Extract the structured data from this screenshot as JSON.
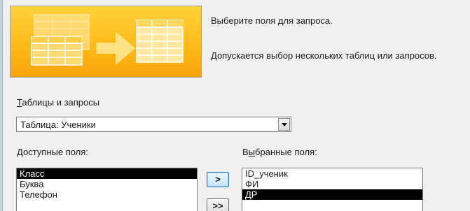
{
  "wizard": {
    "heading": "Выберите поля для запроса.",
    "subheading": "Допускается выбор нескольких таблиц или запросов."
  },
  "source": {
    "label_first": "Т",
    "label_rest": "аблицы и запросы",
    "selected": "Таблица: Ученики"
  },
  "available": {
    "label_first": "Д",
    "label_rest": "оступные поля:",
    "items": [
      {
        "label": "Класс",
        "selected": true
      },
      {
        "label": "Буква",
        "selected": false
      },
      {
        "label": "Телефон",
        "selected": false
      }
    ]
  },
  "chosen": {
    "label_pre": "В",
    "label_underlined": "ы",
    "label_rest": "бранные поля:",
    "items": [
      {
        "label": "ID_ученик",
        "selected": false
      },
      {
        "label": "ФИ",
        "selected": false
      },
      {
        "label": "ДР",
        "selected": true
      }
    ]
  },
  "buttons": {
    "add_one": ">",
    "add_all": ">>"
  },
  "colors": {
    "illustration_bg": "#ffc21f",
    "selection_bg": "#000000",
    "window_bg": "#f0f0f0"
  },
  "icons": {
    "illustration": "tables-to-query-icon",
    "combo_arrow": "chevron-down-icon"
  }
}
